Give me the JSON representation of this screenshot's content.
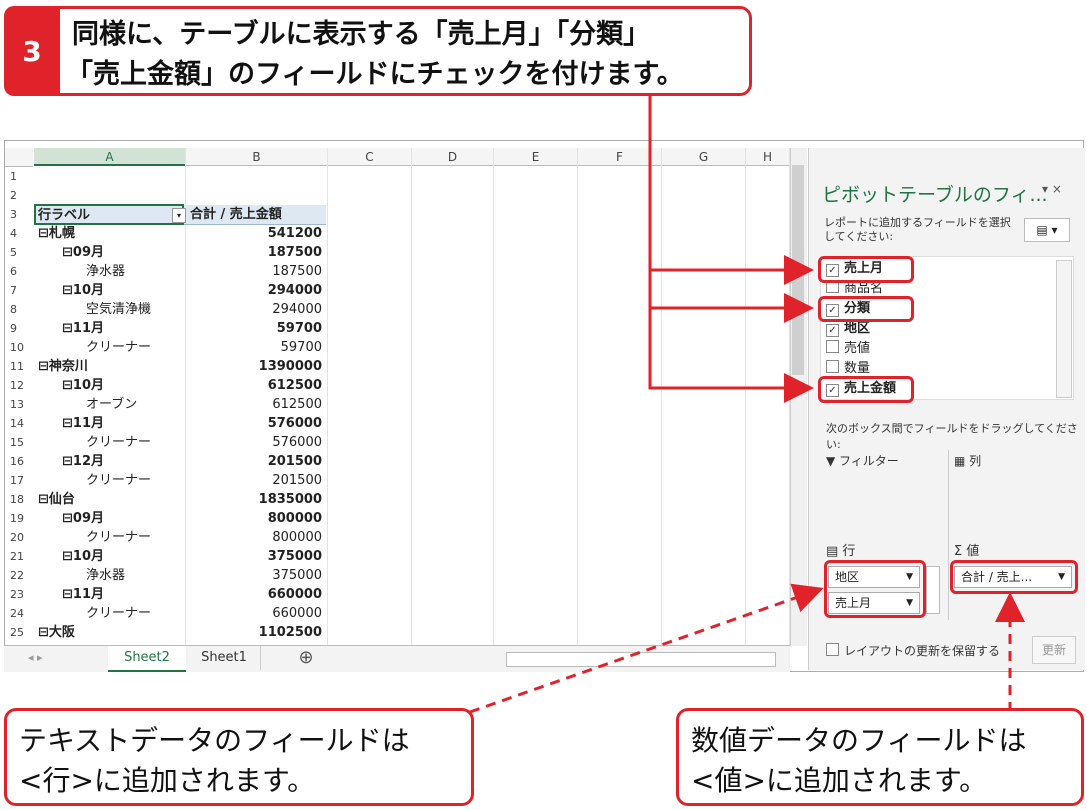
{
  "step": {
    "number": "3",
    "line1": "同様に、テーブルに表示する「売上月」「分類」",
    "line2": "「売上金額」のフィールドにチェックを付けます。"
  },
  "sheet": {
    "columns": [
      "A",
      "B",
      "C",
      "D",
      "E",
      "F",
      "G",
      "H"
    ],
    "header": {
      "row_label": "行ラベル",
      "value_label": "合計 / 売上金額"
    },
    "rows": [
      {
        "n": "1",
        "a": "",
        "b": "",
        "bold": false,
        "indent": 0
      },
      {
        "n": "2",
        "a": "",
        "b": "",
        "bold": false,
        "indent": 0
      },
      {
        "n": "3",
        "a": "",
        "b": "",
        "bold": false,
        "indent": 0
      },
      {
        "n": "4",
        "a": "⊟札幌",
        "b": "541200",
        "bold": true,
        "indent": 0
      },
      {
        "n": "5",
        "a": "⊟09月",
        "b": "187500",
        "bold": true,
        "indent": 1
      },
      {
        "n": "6",
        "a": "浄水器",
        "b": "187500",
        "bold": false,
        "indent": 2
      },
      {
        "n": "7",
        "a": "⊟10月",
        "b": "294000",
        "bold": true,
        "indent": 1
      },
      {
        "n": "8",
        "a": "空気清浄機",
        "b": "294000",
        "bold": false,
        "indent": 2
      },
      {
        "n": "9",
        "a": "⊟11月",
        "b": "59700",
        "bold": true,
        "indent": 1
      },
      {
        "n": "10",
        "a": "クリーナー",
        "b": "59700",
        "bold": false,
        "indent": 2
      },
      {
        "n": "11",
        "a": "⊟神奈川",
        "b": "1390000",
        "bold": true,
        "indent": 0
      },
      {
        "n": "12",
        "a": "⊟10月",
        "b": "612500",
        "bold": true,
        "indent": 1
      },
      {
        "n": "13",
        "a": "オーブン",
        "b": "612500",
        "bold": false,
        "indent": 2
      },
      {
        "n": "14",
        "a": "⊟11月",
        "b": "576000",
        "bold": true,
        "indent": 1
      },
      {
        "n": "15",
        "a": "クリーナー",
        "b": "576000",
        "bold": false,
        "indent": 2
      },
      {
        "n": "16",
        "a": "⊟12月",
        "b": "201500",
        "bold": true,
        "indent": 1
      },
      {
        "n": "17",
        "a": "クリーナー",
        "b": "201500",
        "bold": false,
        "indent": 2
      },
      {
        "n": "18",
        "a": "⊟仙台",
        "b": "1835000",
        "bold": true,
        "indent": 0
      },
      {
        "n": "19",
        "a": "⊟09月",
        "b": "800000",
        "bold": true,
        "indent": 1
      },
      {
        "n": "20",
        "a": "クリーナー",
        "b": "800000",
        "bold": false,
        "indent": 2
      },
      {
        "n": "21",
        "a": "⊟10月",
        "b": "375000",
        "bold": true,
        "indent": 1
      },
      {
        "n": "22",
        "a": "浄水器",
        "b": "375000",
        "bold": false,
        "indent": 2
      },
      {
        "n": "23",
        "a": "⊟11月",
        "b": "660000",
        "bold": true,
        "indent": 1
      },
      {
        "n": "24",
        "a": "クリーナー",
        "b": "660000",
        "bold": false,
        "indent": 2
      },
      {
        "n": "25",
        "a": "⊟大阪",
        "b": "1102500",
        "bold": true,
        "indent": 0
      }
    ],
    "tabs": [
      "Sheet2",
      "Sheet1"
    ],
    "active_tab": "Sheet2",
    "add_sheet": "⊕"
  },
  "pivot": {
    "title": "ピボットテーブルのフィ...",
    "instruction": "レポートに追加するフィールドを選択してください:",
    "fields": [
      {
        "label": "売上月",
        "checked": true
      },
      {
        "label": "商品名",
        "checked": false
      },
      {
        "label": "分類",
        "checked": true
      },
      {
        "label": "地区",
        "checked": true
      },
      {
        "label": "売値",
        "checked": false
      },
      {
        "label": "数量",
        "checked": false
      },
      {
        "label": "売上金額",
        "checked": true
      }
    ],
    "drag_hint": "次のボックス間でフィールドをドラッグしてください:",
    "filter_label": "フィルター",
    "columns_label": "列",
    "rows_label": "行",
    "values_label": "値",
    "row_items": [
      "地区",
      "売上月"
    ],
    "value_items": [
      "合計 / 売上..."
    ],
    "defer_label": "レイアウトの更新を保留する",
    "update_button": "更新"
  },
  "callouts": {
    "text_line1": "テキストデータのフィールドは",
    "text_line2": "<行>に追加されます。",
    "num_line1": "数値データのフィールドは",
    "num_line2": "<値>に追加されます。"
  }
}
